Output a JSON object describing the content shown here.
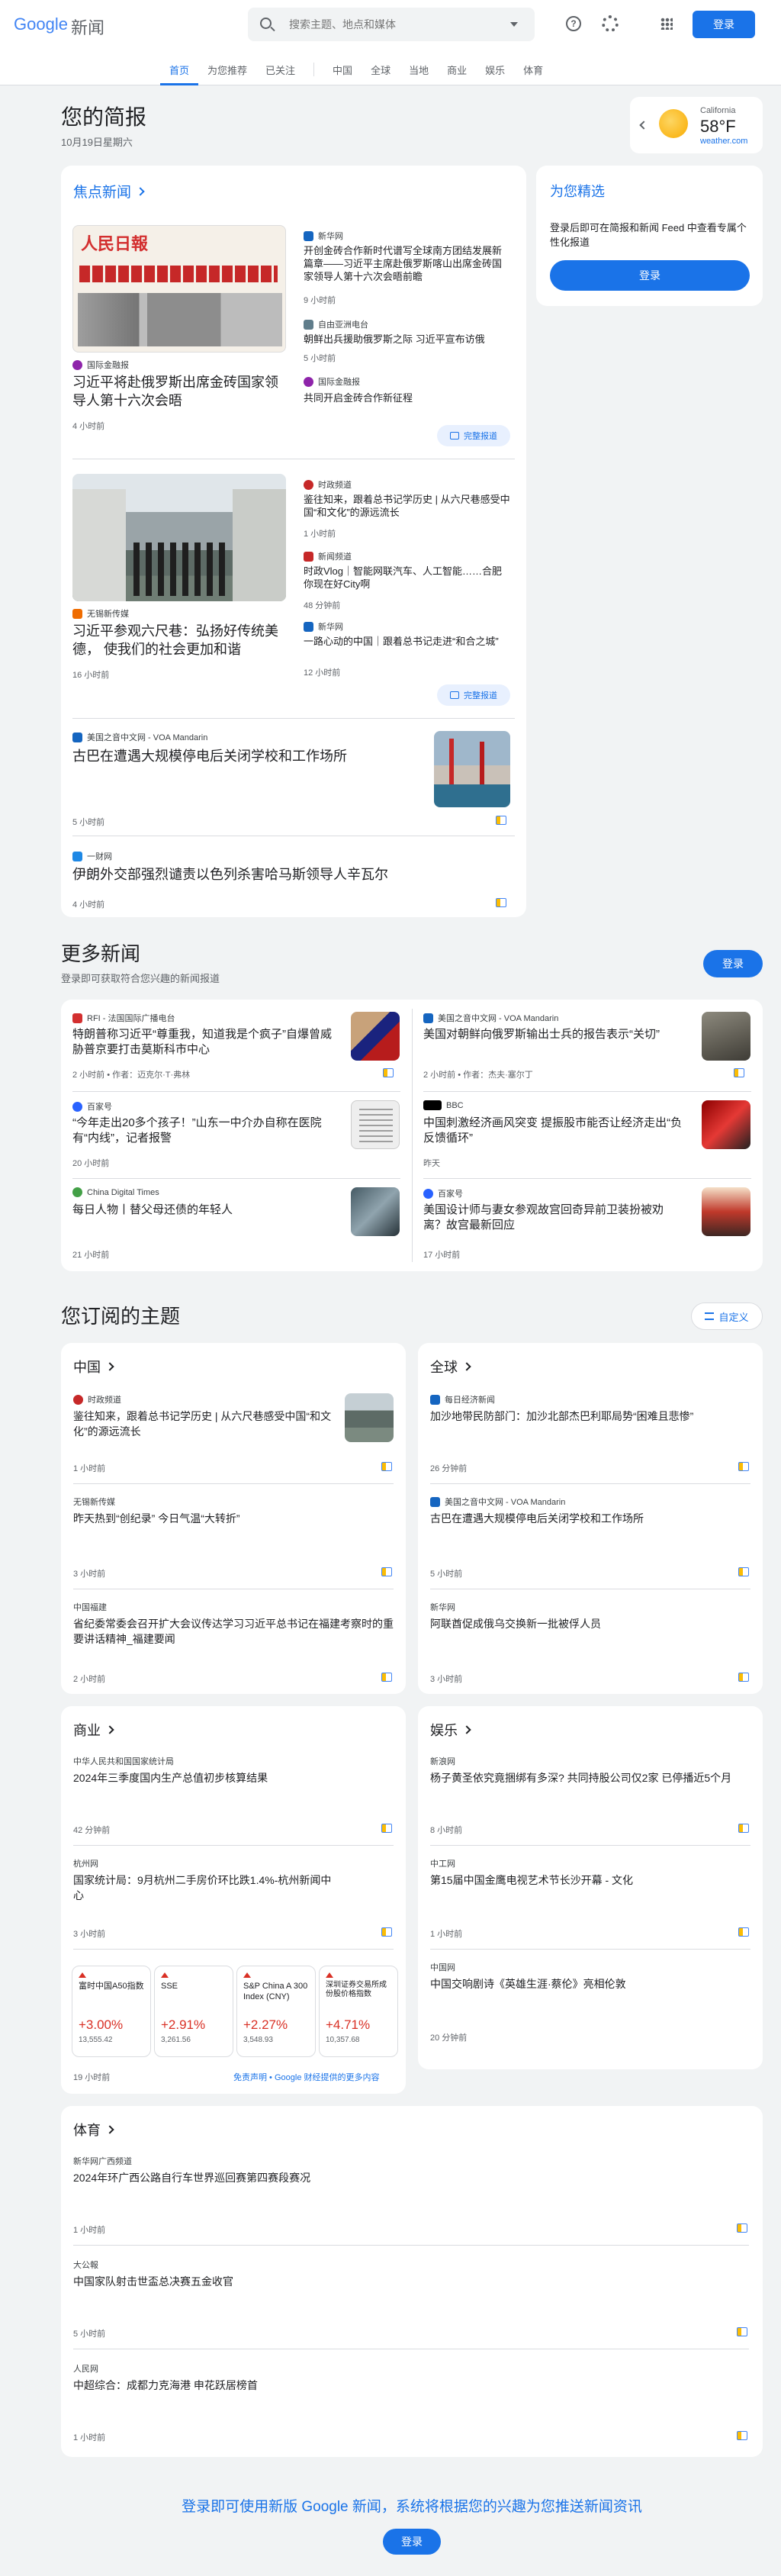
{
  "header": {
    "logo_word": "Google",
    "logo_suffix": "新闻",
    "search_placeholder": "搜索主题、地点和媒体",
    "signin": "登录",
    "tabs": [
      "首页",
      "为您推荐",
      "已关注",
      "中国",
      "全球",
      "当地",
      "商业",
      "娱乐",
      "体育"
    ]
  },
  "brief": {
    "title": "您的简报",
    "date": "10月19日星期六"
  },
  "weather": {
    "city": "California",
    "temp": "58°F",
    "source": "weather.com"
  },
  "top": {
    "title": "焦点新闻",
    "c1": {
      "main_source": "国际金融报",
      "main_title": "习近平将赴俄罗斯出席金砖国家领导人第十六次会晤",
      "main_time": "4 小时前",
      "subs": [
        {
          "source": "新华网",
          "title": "开创金砖合作新时代谱写全球南方团结发展新篇章——习近平主席赴俄罗斯喀山出席金砖国家领导人第十六次会晤前瞻",
          "time": "9 小时前"
        },
        {
          "source": "自由亚洲电台",
          "title": "朝鲜出兵援助俄罗斯之际 习近平宣布访俄",
          "time": "5 小时前"
        },
        {
          "source": "国际金融报",
          "title": "共同开启金砖合作新征程",
          "time": ""
        }
      ],
      "full": "完整报道"
    },
    "c2": {
      "main_source": "无锡新传媒",
      "main_title": "习近平参观六尺巷：弘扬好传统美德， 使我们的社会更加和谐",
      "main_time": "16 小时前",
      "subs": [
        {
          "source": "时政频道",
          "title": "鉴往知来，跟着总书记学历史 | 从六尺巷感受中国“和文化”的源远流长",
          "time": "1 小时前"
        },
        {
          "source": "新闻频道",
          "title": "时政Vlog｜智能网联汽车、人工智能……合肥你现在好City啊",
          "time": "48 分钟前"
        },
        {
          "source": "新华网",
          "title": "一路心动的中国｜跟着总书记走进“和合之城”",
          "time": "12 小时前"
        }
      ],
      "full": "完整报道"
    },
    "s1": {
      "source": "美国之音中文网 - VOA Mandarin",
      "title": "古巴在遭遇大规模停电后关闭学校和工作场所",
      "time": "5 小时前"
    },
    "s2": {
      "source": "一财网",
      "title": "伊朗外交部强烈谴责以色列杀害哈马斯领导人辛瓦尔",
      "time": "4 小时前"
    }
  },
  "picks": {
    "title": "为您精选",
    "text": "登录后即可在简报和新闻 Feed 中查看专属个性化报道",
    "button": "登录"
  },
  "more": {
    "title": "更多新闻",
    "subtitle": "登录即可获取符合您兴趣的新闻报道",
    "button": "登录",
    "items": [
      {
        "source": "RFI - 法国国际广播电台",
        "title": "特朗普称习近平“尊重我，知道我是个疯子”自爆曾威胁普京要打击莫斯科市中心",
        "time": "2 小时前 • 作者：迈克尔·T·弗林"
      },
      {
        "source": "美国之音中文网 - VOA Mandarin",
        "title": "美国对朝鲜向俄罗斯输出士兵的报告表示“关切”",
        "time": "2 小时前 • 作者：杰夫·塞尔丁"
      },
      {
        "source": "百家号",
        "title": "“今年走出20多个孩子！”山东一中介办自称在医院有“内线”，记者报警",
        "time": "20 小时前"
      },
      {
        "source": "BBC",
        "title": "中国刺激经济画风突变 提振股市能否让经济走出“负反馈循环”",
        "time": "昨天"
      },
      {
        "source": "China Digital Times",
        "title": "每日人物丨替父母还债的年轻人",
        "time": "21 小时前"
      },
      {
        "source": "百家号",
        "title": "美国设计师与妻女参观故宫回奇异前卫装扮被劝离？故宫最新回应",
        "time": "17 小时前"
      }
    ]
  },
  "topics": {
    "title": "您订阅的主题",
    "customize": "自定义",
    "china": {
      "title": "中国",
      "items": [
        {
          "source": "时政频道",
          "title": "鉴往知来，跟着总书记学历史 | 从六尺巷感受中国“和文化”的源远流长",
          "time": "1 小时前"
        },
        {
          "source": "无锡新传媒",
          "title": "昨天热到“创纪录” 今日气温“大转折”",
          "time": "3 小时前"
        },
        {
          "source": "中国福建",
          "title": "省纪委常委会召开扩大会议传达学习习近平总书记在福建考察时的重要讲话精神_福建要闻",
          "time": "2 小时前"
        }
      ]
    },
    "world": {
      "title": "全球",
      "items": [
        {
          "source": "每日经济新闻",
          "title": "加沙地带民防部门：加沙北部杰巴利耶局势“困难且悲惨”",
          "time": "26 分钟前"
        },
        {
          "source": "美国之音中文网 - VOA Mandarin",
          "title": "古巴在遭遇大规模停电后关闭学校和工作场所",
          "time": "5 小时前"
        },
        {
          "source": "新华网",
          "title": "阿联酋促成俄乌交换新一批被俘人员",
          "time": "3 小时前"
        }
      ]
    },
    "biz": {
      "title": "商业",
      "items": [
        {
          "source": "中华人民共和国国家统计局",
          "title": "2024年三季度国内生产总值初步核算结果",
          "time": "42 分钟前"
        },
        {
          "source": "杭州网",
          "title": "国家统计局：9月杭州二手房价环比跌1.4%-杭州新闻中心",
          "time": "3 小时前"
        }
      ],
      "stocks": [
        {
          "name": "富时中国A50指数",
          "pct": "+3.00%",
          "val": "13,555.42"
        },
        {
          "name": "SSE",
          "pct": "+2.91%",
          "val": "3,261.56"
        },
        {
          "name": "S&P China A 300 Index (CNY)",
          "pct": "+2.27%",
          "val": "3,548.93"
        },
        {
          "name": "深圳证券交易所成份股价格指数",
          "pct": "+4.71%",
          "val": "10,357.68"
        }
      ],
      "stocks_time": "19 小时前",
      "disclaimer": "免责声明 • Google 财经提供的更多内容"
    },
    "ent": {
      "title": "娱乐",
      "items": [
        {
          "source": "新浪网",
          "title": "杨子黄圣依究竟捆绑有多深? 共同持股公司仅2家 已停播近5个月",
          "time": "8 小时前"
        },
        {
          "source": "中工网",
          "title": "第15届中国金鹰电视艺术节长沙开幕 - 文化",
          "time": "1 小时前"
        },
        {
          "source": "中国网",
          "title": "中国交响剧诗《英雄生涯·蔡伦》亮相伦敦",
          "time": "20 分钟前"
        }
      ]
    },
    "sports": {
      "title": "体育",
      "items": [
        {
          "source": "新华网广西频道",
          "title": "2024年环广西公路自行车世界巡回赛第四赛段赛况",
          "time": "1 小时前"
        },
        {
          "source": "大公報",
          "title": "中国家队射击世盃总决赛五金收官",
          "time": "5 小时前"
        },
        {
          "source": "人民网",
          "title": "中超综合：成都力克海港 申花跃居榜首",
          "time": "1 小时前"
        }
      ]
    }
  },
  "footer": {
    "text": "登录即可使用新版 Google 新闻，系统将根据您的兴趣为您推送新闻资讯",
    "button": "登录"
  }
}
